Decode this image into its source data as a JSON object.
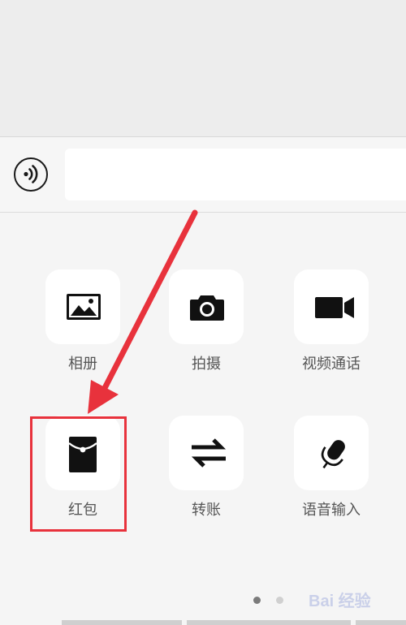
{
  "input_bar": {
    "voice_icon": "voice-wave-icon",
    "input_value": "",
    "input_placeholder": ""
  },
  "tools": [
    {
      "label": "相册",
      "icon": "photo-album-icon"
    },
    {
      "label": "拍摄",
      "icon": "camera-icon"
    },
    {
      "label": "视频通话",
      "icon": "video-call-icon"
    },
    {
      "label": "红包",
      "icon": "red-packet-icon"
    },
    {
      "label": "转账",
      "icon": "transfer-arrows-icon"
    },
    {
      "label": "语音输入",
      "icon": "microphone-icon"
    }
  ],
  "annotation": {
    "color": "#e8323c",
    "target": "红包"
  },
  "pagination": {
    "current_page": 1,
    "total_pages": 2
  },
  "watermark": {
    "text": "Bai 经验"
  },
  "colors": {
    "panel_background": "#f5f5f5",
    "tile_background": "#ffffff",
    "label_color": "#555555",
    "annotation_red": "#e8323c"
  }
}
